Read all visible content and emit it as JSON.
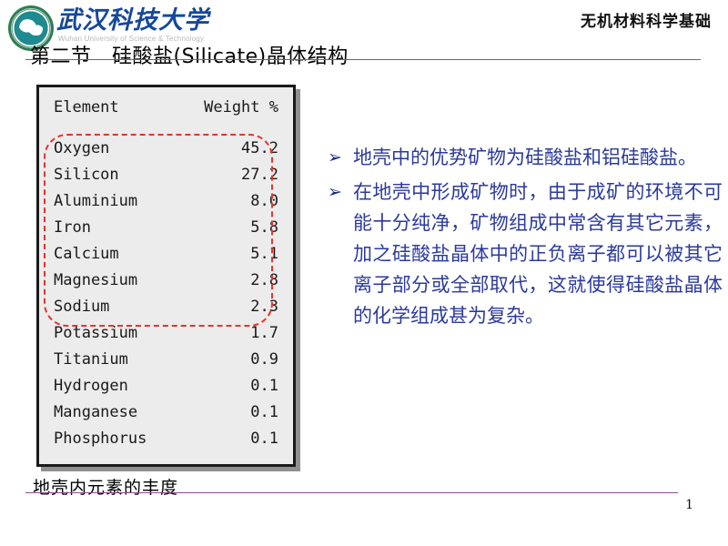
{
  "header": {
    "university_name": "武汉科技大学",
    "university_name_en": "Wuhan University of Science & Technology",
    "course_title": "无机材料科学基础",
    "logo_icon": "university-seal-icon"
  },
  "section": {
    "title": "第二节　硅酸盐(Silicate)晶体结构",
    "rule_color": "#8c4f8c"
  },
  "table": {
    "caption": "地壳内元素的丰度",
    "headers": [
      "Element",
      "Weight %"
    ],
    "rows": [
      {
        "element": "Oxygen",
        "weight": "45.2"
      },
      {
        "element": "Silicon",
        "weight": "27.2"
      },
      {
        "element": "Aluminium",
        "weight": "8.0"
      },
      {
        "element": "Iron",
        "weight": "5.8"
      },
      {
        "element": "Calcium",
        "weight": "5.1"
      },
      {
        "element": "Magnesium",
        "weight": "2.8"
      },
      {
        "element": "Sodium",
        "weight": "2.3"
      },
      {
        "element": "Potassium",
        "weight": "1.7"
      },
      {
        "element": "Titanium",
        "weight": "0.9"
      },
      {
        "element": "Hydrogen",
        "weight": "0.1"
      },
      {
        "element": "Manganese",
        "weight": "0.1"
      },
      {
        "element": "Phosphorus",
        "weight": "0.1"
      }
    ],
    "highlight_color": "#e8322c",
    "panel_background": "#ececec",
    "panel_border": "#1a1a1a"
  },
  "bullets": {
    "marker": "➢",
    "text_color": "#2b3a9c",
    "items": [
      "地壳中的优势矿物为硅酸盐和铝硅酸盐。",
      "在地壳中形成矿物时，由于成矿的环境不可能十分纯净，矿物组成中常含有其它元素，加之硅酸盐晶体中的正负离子都可以被其它离子部分或全部取代，这就使得硅酸盐晶体的化学组成甚为复杂。"
    ]
  },
  "footer": {
    "page_number": "1"
  },
  "chart_data": {
    "type": "table",
    "title": "地壳内元素的丰度",
    "columns": [
      "Element",
      "Weight %"
    ],
    "categories": [
      "Oxygen",
      "Silicon",
      "Aluminium",
      "Iron",
      "Calcium",
      "Magnesium",
      "Sodium",
      "Potassium",
      "Titanium",
      "Hydrogen",
      "Manganese",
      "Phosphorus"
    ],
    "values": [
      45.2,
      27.2,
      8.0,
      5.8,
      5.1,
      2.8,
      2.3,
      1.7,
      0.9,
      0.1,
      0.1,
      0.1
    ],
    "ylabel": "Weight %",
    "highlighted_categories": [
      "Oxygen",
      "Silicon",
      "Aluminium",
      "Iron",
      "Calcium",
      "Magnesium",
      "Sodium"
    ]
  }
}
